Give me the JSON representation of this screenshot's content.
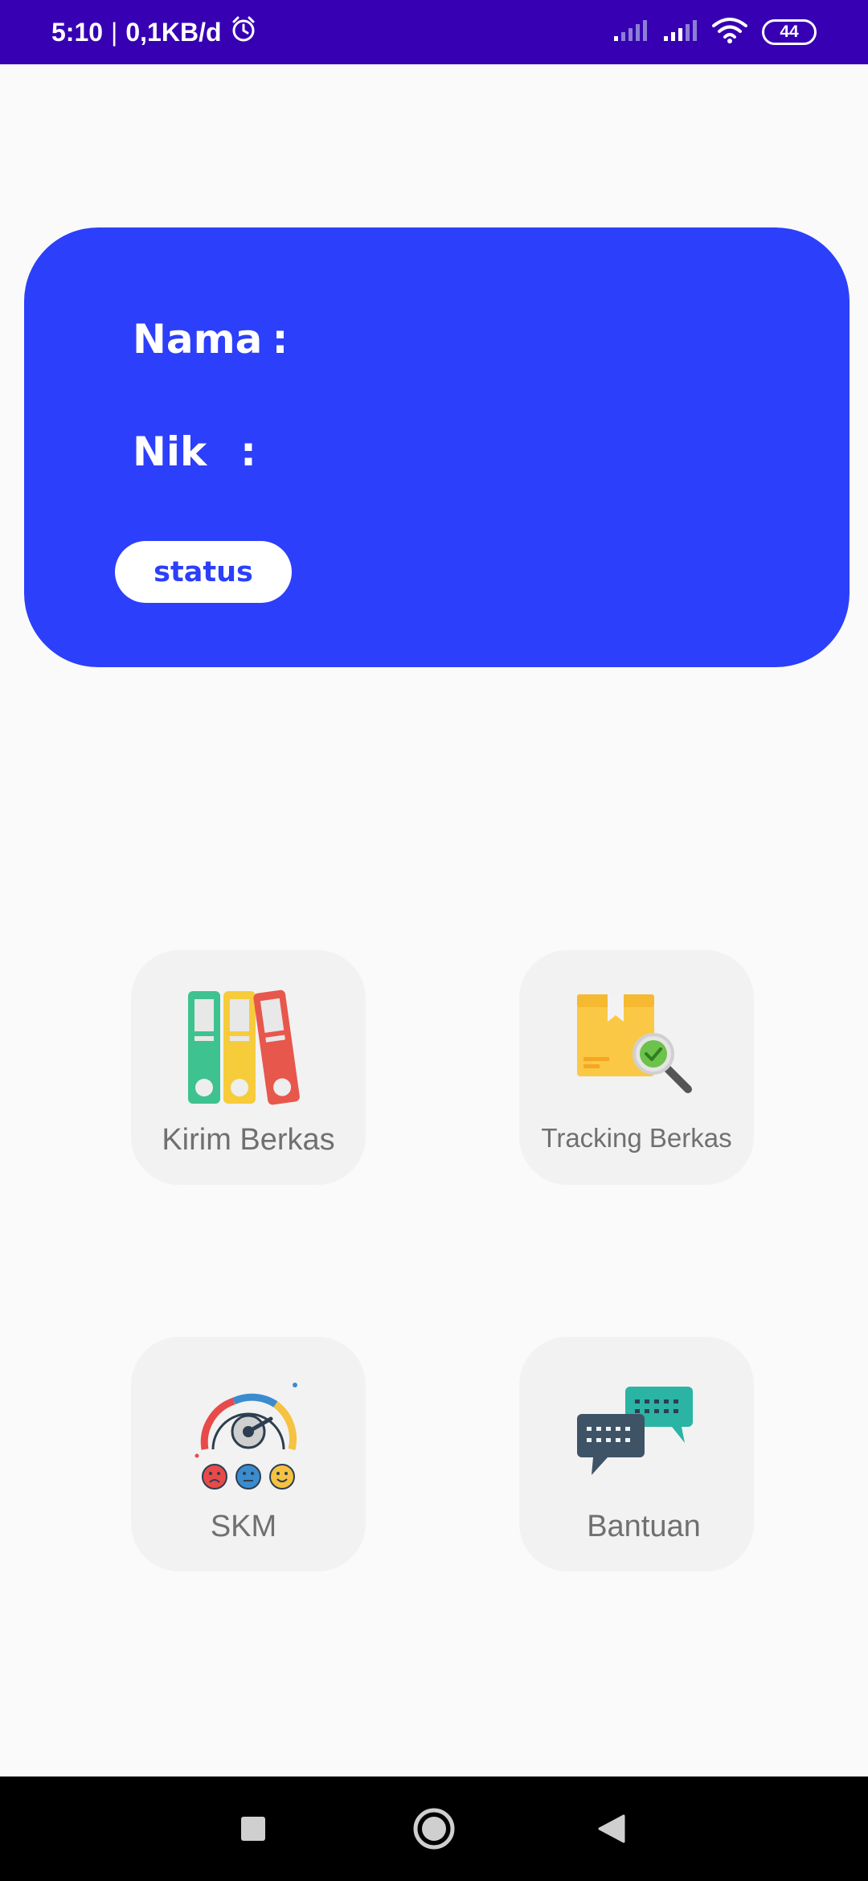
{
  "status_bar": {
    "time": "5:10",
    "separator": "|",
    "data_rate": "0,1KB/d",
    "battery": "44",
    "background_color": "#3700b3"
  },
  "profile_card": {
    "name_label": "Nama",
    "name_colon": ":",
    "nik_label": "Nik",
    "nik_colon": ":",
    "status_button": "status",
    "background_color": "#2c3ffa"
  },
  "menu": {
    "kirim_berkas": {
      "label": "Kirim Berkas",
      "icon": "binders-icon"
    },
    "tracking_berkas": {
      "label": "Tracking Berkas",
      "icon": "package-search-icon"
    },
    "skm": {
      "label": "SKM",
      "icon": "satisfaction-meter-icon"
    },
    "bantuan": {
      "label": "Bantuan",
      "icon": "chat-bubbles-icon"
    }
  },
  "nav_bar": {
    "recents": "square-icon",
    "home": "circle-icon",
    "back": "triangle-back-icon"
  }
}
